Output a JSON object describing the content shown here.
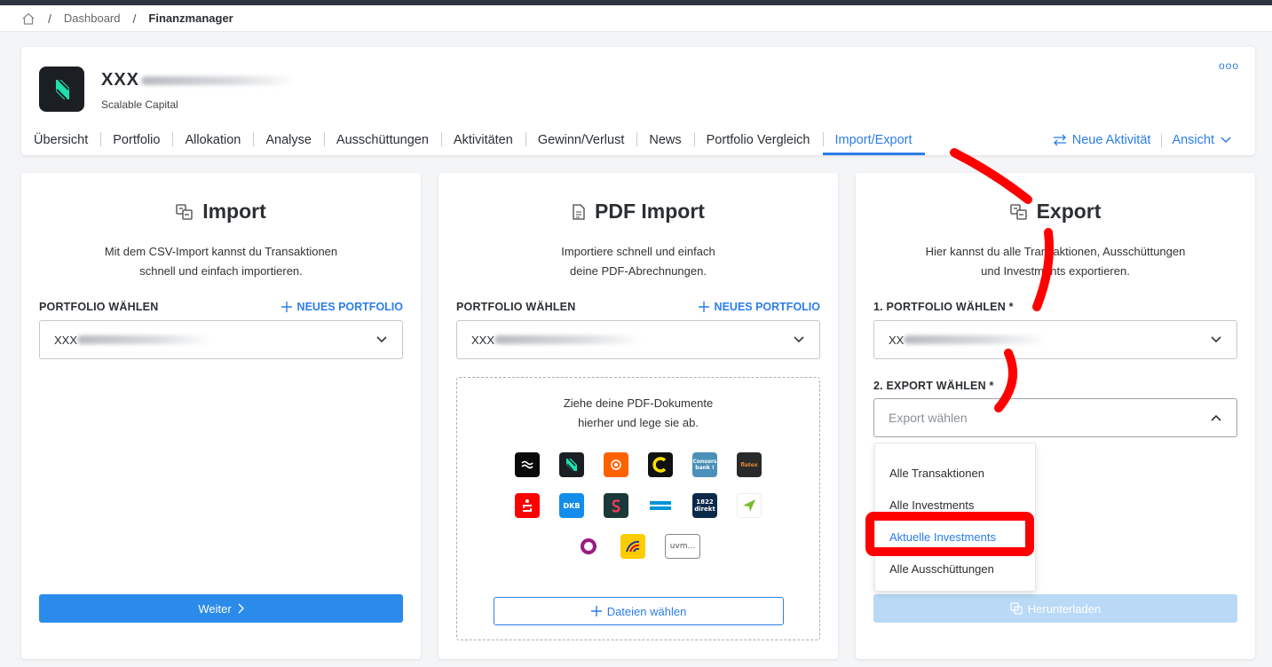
{
  "breadcrumb": {
    "items": [
      "Dashboard",
      "Finanzmanager"
    ]
  },
  "portfolio": {
    "name": "XXX",
    "broker": "Scalable Capital"
  },
  "tabs": [
    "Übersicht",
    "Portfolio",
    "Allokation",
    "Analyse",
    "Ausschüttungen",
    "Aktivitäten",
    "Gewinn/Verlust",
    "News",
    "Portfolio Vergleich",
    "Import/Export"
  ],
  "active_tab": "Import/Export",
  "actions": {
    "new_activity": "Neue Aktivität",
    "view": "Ansicht",
    "more": "ooo"
  },
  "import": {
    "title": "Import",
    "desc_line1": "Mit dem CSV-Import kannst du Transaktionen",
    "desc_line2": "schnell und einfach importieren.",
    "label": "PORTFOLIO WÄHLEN",
    "new_portfolio": "NEUES PORTFOLIO",
    "selected": "XXX",
    "button": "Weiter"
  },
  "pdf_import": {
    "title": "PDF Import",
    "desc_line1": "Importiere schnell und einfach",
    "desc_line2": "deine PDF-Abrechnungen.",
    "label": "PORTFOLIO WÄHLEN",
    "new_portfolio": "NEUES PORTFOLIO",
    "selected": "XXX",
    "drop_line1": "Ziehe deine PDF-Dokumente",
    "drop_line2": "hierher und lege sie ab.",
    "more_label": "uvm...",
    "brokers": [
      "trade-republic",
      "scalable-capital",
      "ing",
      "consorsbank-c",
      "consorsbank",
      "flatex",
      "sparkasse",
      "dkb",
      "smartbroker",
      "comdirect",
      "1822direkt",
      "onvista",
      "o-broker",
      "postbank",
      "uvm"
    ],
    "consors_label": "Consors bank !",
    "flatex_label": "flatex",
    "dkb_label": "DKB",
    "direkt_label": "1822 direkt",
    "button": "Dateien wählen"
  },
  "export": {
    "title": "Export",
    "desc_line1": "Hier kannst du alle Transaktionen, Ausschüttungen",
    "desc_line2": "und Investments exportieren.",
    "label1": "1. PORTFOLIO WÄHLEN *",
    "selected": "XX",
    "label2": "2. EXPORT WÄHLEN *",
    "placeholder": "Export wählen",
    "options": [
      "Alle Transaktionen",
      "Alle Investments",
      "Aktuelle Investments",
      "Alle Ausschüttungen"
    ],
    "highlighted": "Aktuelle Investments",
    "button": "Herunterladen"
  },
  "colors": {
    "accent": "#2b7de9",
    "annotation": "#ff0000",
    "button": "#2b8bea"
  }
}
